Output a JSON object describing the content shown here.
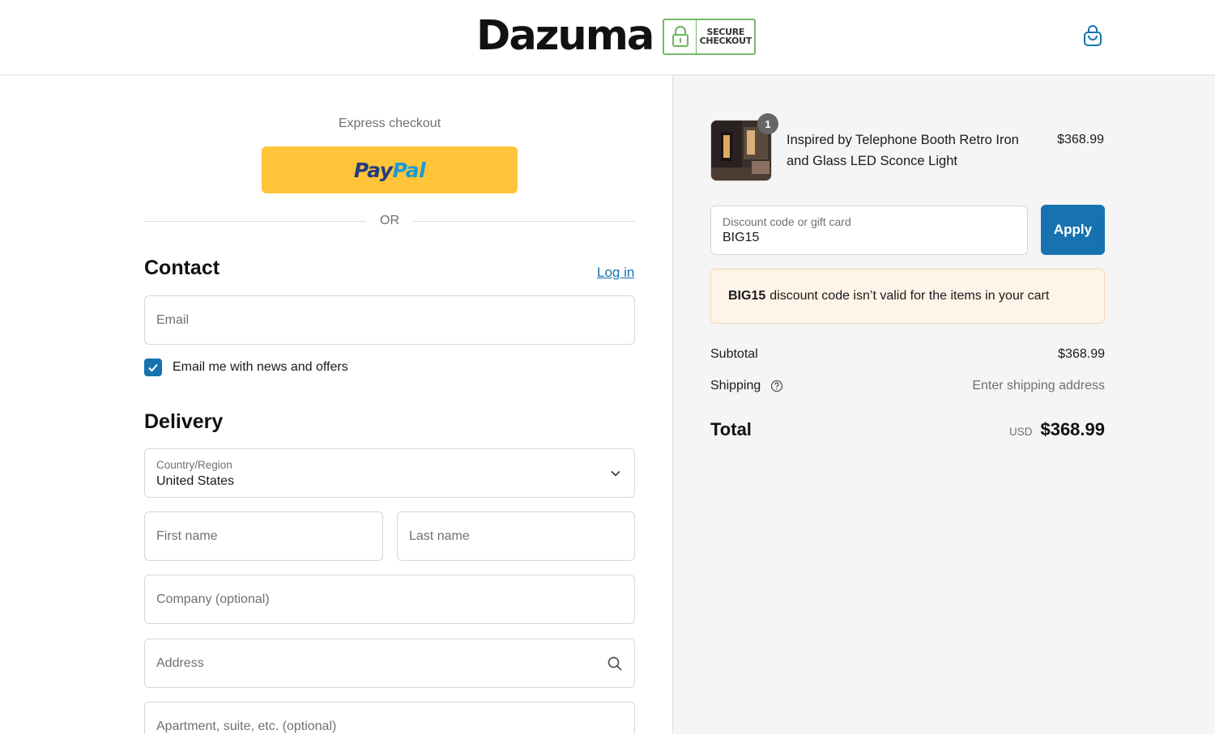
{
  "header": {
    "brand": "Dazuma",
    "badge_line1": "SECURE",
    "badge_line2": "CHECKOUT",
    "cart_icon": "shopping-bag-icon"
  },
  "express": {
    "label": "Express checkout",
    "paypal_part1": "Pay",
    "paypal_part2": "Pal",
    "or_text": "OR"
  },
  "contact": {
    "title": "Contact",
    "login_label": "Log in",
    "email_placeholder": "Email",
    "newsletter_label": "Email me with news and offers",
    "newsletter_checked": true
  },
  "delivery": {
    "title": "Delivery",
    "country_label": "Country/Region",
    "country_value": "United States",
    "first_name_placeholder": "First name",
    "last_name_placeholder": "Last name",
    "company_placeholder": "Company (optional)",
    "address_placeholder": "Address",
    "apartment_placeholder": "Apartment, suite, etc. (optional)"
  },
  "summary": {
    "item": {
      "quantity": "1",
      "name": "Inspired by Telephone Booth Retro Iron and Glass LED Sconce Light",
      "price": "$368.99"
    },
    "discount_label": "Discount code or gift card",
    "discount_value": "BIG15",
    "apply_label": "Apply",
    "warning_code": "BIG15",
    "warning_text": "discount code isn’t valid for the items in your cart",
    "subtotal_label": "Subtotal",
    "subtotal_value": "$368.99",
    "shipping_label": "Shipping",
    "shipping_value": "Enter shipping address",
    "total_label": "Total",
    "currency": "USD",
    "total_value": "$368.99"
  },
  "colors": {
    "accent": "#1773b0",
    "paypal_yellow": "#ffc439",
    "badge_green": "#76b86a",
    "warning_bg": "#fff4e8"
  }
}
